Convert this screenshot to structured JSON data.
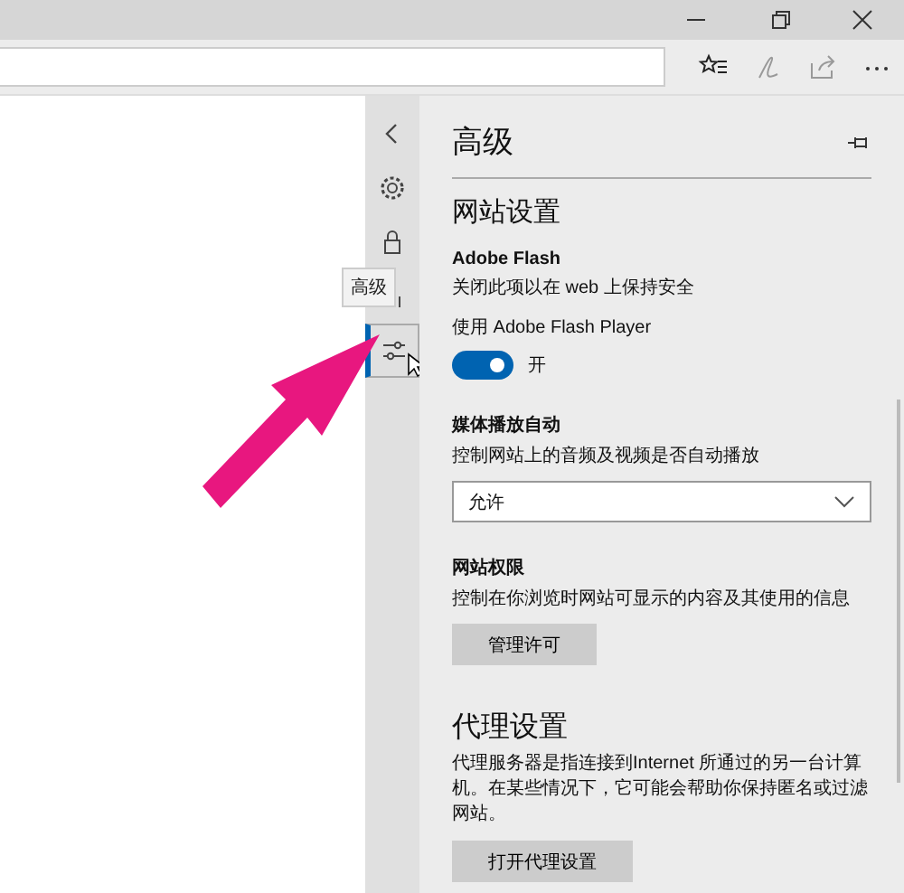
{
  "rail": {
    "items": [
      {
        "kind": "back",
        "selected": false
      },
      {
        "kind": "settings",
        "selected": false
      },
      {
        "kind": "lock",
        "selected": false
      },
      {
        "kind": "hidden",
        "selected": false
      },
      {
        "kind": "advanced",
        "selected": true
      }
    ],
    "tooltip": "高级"
  },
  "panel": {
    "title": "高级",
    "section_title": "网站设置",
    "flash": {
      "title": "Adobe Flash",
      "description": "关闭此项以在 web 上保持安全",
      "toggle_label": "使用 Adobe Flash Player",
      "on": true,
      "state_text": "开"
    },
    "autoplay": {
      "title": "媒体播放自动",
      "description": "控制网站上的音频及视频是否自动播放",
      "value": "允许"
    },
    "permissions": {
      "title": "网站权限",
      "description": "控制在你浏览时网站可显示的内容及其使用的信息",
      "button": "管理许可"
    },
    "proxy": {
      "title": "代理设置",
      "description": "代理服务器是指连接到Internet 所通过的另一台计算机。在某些情况下，它可能会帮助你保持匿名或过滤网站。",
      "button": "打开代理设置"
    }
  }
}
